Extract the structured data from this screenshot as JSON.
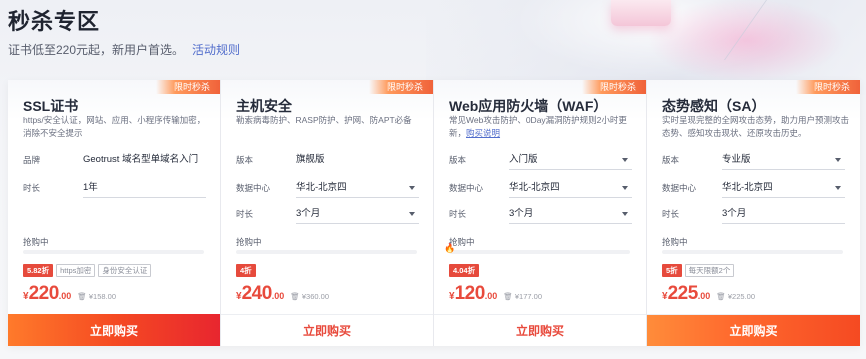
{
  "page": {
    "title": "秒杀专区",
    "subtitle": "证书低至220元起，新用户首选。",
    "rules_link": "活动规则"
  },
  "labels": {
    "ribbon": "限时秒杀",
    "buying": "抢购中",
    "buy_button": "立即购买",
    "original_price_prefix": "¥"
  },
  "cards": [
    {
      "title": "SSL证书",
      "desc": "https/安全认证，网站、应用、小程序传输加密，消除不安全提示",
      "desc_link": "",
      "rows": [
        {
          "label": "品牌",
          "value": "Geotrust 域名型单域名入门",
          "dropdown": false
        },
        {
          "label": "时长",
          "value": "1年",
          "dropdown": false
        }
      ],
      "discount": "5.82折",
      "tags": [
        "https加密",
        "身份安全认证"
      ],
      "price_currency": "¥",
      "price_int": "220",
      "price_dec": ".00",
      "original_price": "¥158.00",
      "progress": 0.0
    },
    {
      "title": "主机安全",
      "desc": "勒索病毒防护、RASP防护、护网、防APT必备",
      "desc_link": "",
      "rows": [
        {
          "label": "版本",
          "value": "旗舰版",
          "dropdown": false
        },
        {
          "label": "数据中心",
          "value": "华北-北京四",
          "dropdown": true
        },
        {
          "label": "时长",
          "value": "3个月",
          "dropdown": true
        }
      ],
      "discount": "4折",
      "tags": [],
      "price_currency": "¥",
      "price_int": "240",
      "price_dec": ".00",
      "original_price": "¥360.00",
      "progress": 0.0
    },
    {
      "title": "Web应用防火墙（WAF）",
      "desc": "常见Web攻击防护、0Day漏洞防护规则2小时更新，",
      "desc_link": "购买说明",
      "rows": [
        {
          "label": "版本",
          "value": "入门版",
          "dropdown": true
        },
        {
          "label": "数据中心",
          "value": "华北-北京四",
          "dropdown": true
        },
        {
          "label": "时长",
          "value": "3个月",
          "dropdown": true
        }
      ],
      "discount": "4.04折",
      "tags": [],
      "price_currency": "¥",
      "price_int": "120",
      "price_dec": ".00",
      "original_price": "¥177.00",
      "progress": 0.0
    },
    {
      "title": "态势感知（SA）",
      "desc": "实时呈现完整的全网攻击态势，助力用户预测攻击态势、感知攻击现状、还原攻击历史。",
      "desc_link": "",
      "rows": [
        {
          "label": "版本",
          "value": "专业版",
          "dropdown": true
        },
        {
          "label": "数据中心",
          "value": "华北-北京四",
          "dropdown": true
        },
        {
          "label": "时长",
          "value": "3个月",
          "dropdown": false
        }
      ],
      "discount": "5折",
      "tags": [
        "每天限额2个"
      ],
      "price_currency": "¥",
      "price_int": "225",
      "price_dec": ".00",
      "original_price": "¥225.00",
      "progress": 0.0
    }
  ]
}
